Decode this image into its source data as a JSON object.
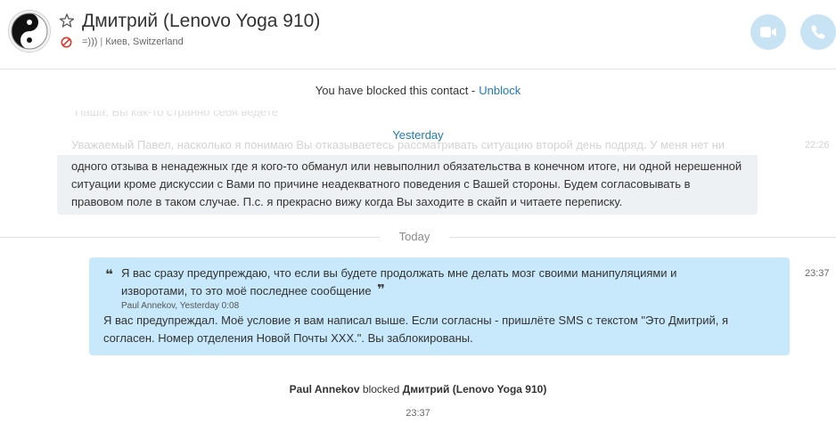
{
  "header": {
    "contact_name": "Дмитрий (Lenovo Yoga 910)",
    "mood_message": "=)))",
    "separator": "|",
    "location": "Киев, Switzerland",
    "avatar_icon": "yin-yang-icon",
    "favorite_icon": "star-outline-icon",
    "blocked_status_icon": "blocked-icon",
    "video_call_icon": "video-camera-icon",
    "audio_call_icon": "phone-icon"
  },
  "blocked_banner": {
    "text": "You have blocked this contact -",
    "unblock_label": "Unblock"
  },
  "conversation": {
    "faded_top_text": "Паша, Вы как-то странно себя ведёте",
    "faded_message_text": "Уважаемый Павел, насколько я понимаю Вы отказываетесь рассматривать ситуацию второй день подряд. У меня нет ни",
    "faded_time": "22:26",
    "yesterday_label": "Yesterday",
    "incoming_message": "одного отзыва в ненадежных где я кого-то обманул или невыполнил обязательства в конечном итоге, ни одной нерешенной ситуации кроме дискуссии с Вами по причине неадекватного поведения с Вашей стороны. Будем согласовывать в правовом поле в таком случае. П.с. я прекрасно вижу когда Вы заходите в скайп и читаете переписку.",
    "today_label": "Today",
    "outgoing": {
      "quote_open": "❝",
      "quote_text": "Я вас сразу предупреждаю, что если вы будете продолжать мне делать мозг своими манипуляциями и изворотами, то это моё последнее сообщение",
      "quote_close": "❞",
      "quote_author": "Paul Annekov, Yesterday 0:08",
      "text": "Я вас предупреждал. Моё условие я вам написал выше. Если согласны - пришлёте SMS с текстом \"Это Дмитрий, я согласен. Номер отделения Новой Почты ХХХ.\". Вы заблокированы.",
      "time": "23:37"
    },
    "system_message": {
      "actor": "Paul Annekov",
      "action": "blocked",
      "target": "Дмитрий (Lenovo Yoga 910)",
      "time": "23:37"
    }
  },
  "colors": {
    "accent": "#1f7ab8",
    "outgoing_bubble": "#c7e9fb",
    "incoming_bubble": "#eef1f4",
    "call_button": "#c7e3f4",
    "blocked_red": "#d9352b"
  }
}
